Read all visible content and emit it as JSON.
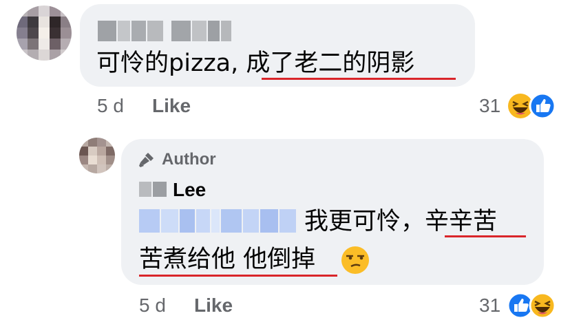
{
  "comment": {
    "text_prefix": "可怜的pizza, ",
    "text_underlined": "成了老二的阴影",
    "time": "5 d",
    "like_label": "Like",
    "reaction_count": "31",
    "reactions": [
      "haha-icon",
      "like-icon"
    ]
  },
  "reply": {
    "badge": "Author",
    "name": "Lee",
    "line1_plain": "我更可怜，",
    "line1_underlined": "辛辛苦",
    "line2_underlined": "苦煮给他 他倒掉",
    "emoji": "unamused-face-icon",
    "time": "5 d",
    "like_label": "Like",
    "reaction_count": "31",
    "reactions": [
      "like-icon",
      "haha-icon"
    ]
  },
  "colors": {
    "bubble": "#eff1f4",
    "meta": "#65676b",
    "underline": "#d9252a",
    "like_blue": "#1877f2"
  }
}
